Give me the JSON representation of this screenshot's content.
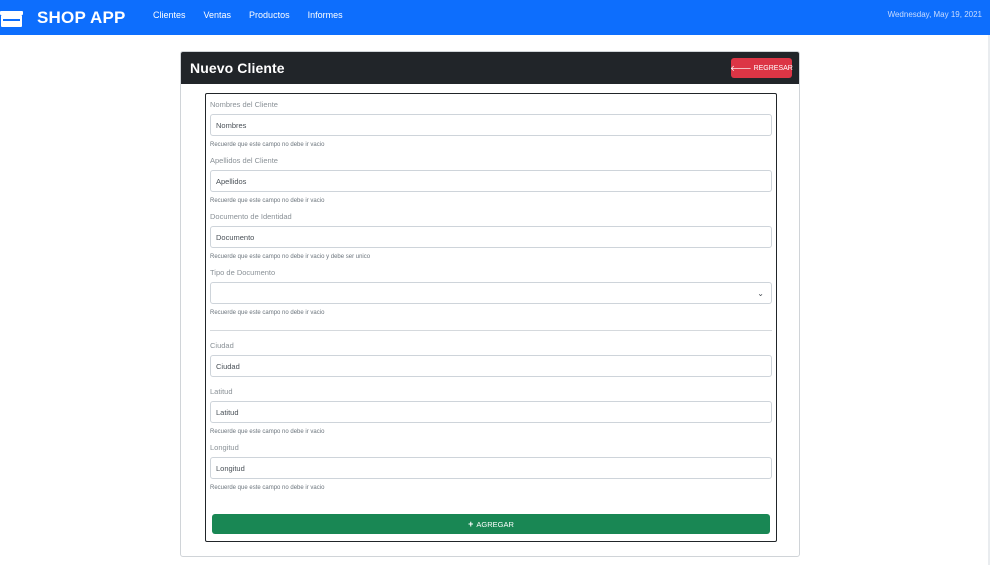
{
  "navbar": {
    "brand": "SHOP APP",
    "brand_icon": "store-icon",
    "links": [
      "Clientes",
      "Ventas",
      "Productos",
      "Informes"
    ],
    "date": "Wednesday, May 19, 2021"
  },
  "card": {
    "title": "Nuevo Cliente",
    "back_label": "REGRESAR",
    "back_icon": "arrow-left-icon",
    "add_label": "AGREGAR",
    "add_icon": "plus-icon"
  },
  "form": {
    "nombres": {
      "label": "Nombres del Cliente",
      "placeholder": "Nombres",
      "help": "Recuerde que este campo no debe ir vacio"
    },
    "apellidos": {
      "label": "Apellidos del Cliente",
      "placeholder": "Apellidos",
      "help": "Recuerde que este campo no debe ir vacio"
    },
    "documento": {
      "label": "Documento de Identidad",
      "placeholder": "Documento",
      "help": "Recuerde que este campo no debe ir vacio y debe ser unico"
    },
    "tipo": {
      "label": "Tipo de Documento",
      "value": "",
      "help": "Recuerde que este campo no debe ir vacio"
    },
    "ciudad": {
      "label": "Ciudad",
      "placeholder": "Ciudad"
    },
    "latitud": {
      "label": "Latitud",
      "placeholder": "Latitud",
      "help": "Recuerde que este campo no debe ir vacio"
    },
    "longitud": {
      "label": "Longitud",
      "placeholder": "Longitud",
      "help": "Recuerde que este campo no debe ir vacio"
    }
  },
  "colors": {
    "navbar": "#0d6efd",
    "header": "#212529",
    "danger": "#dc3545",
    "success": "#198754"
  }
}
